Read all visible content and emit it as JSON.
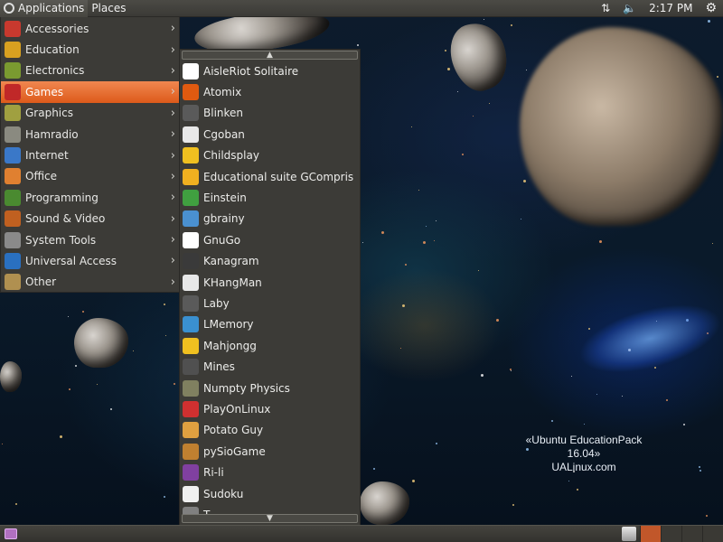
{
  "top_panel": {
    "menus": [
      "Applications",
      "Places"
    ],
    "clock": "2:17 PM"
  },
  "app_menu": {
    "items": [
      {
        "label": "Accessories",
        "icon": "accessories-icon",
        "color": "#c8392e",
        "has_submenu": true
      },
      {
        "label": "Education",
        "icon": "education-icon",
        "color": "#d8a020",
        "has_submenu": true
      },
      {
        "label": "Electronics",
        "icon": "electronics-icon",
        "color": "#7a9a30",
        "has_submenu": true
      },
      {
        "label": "Games",
        "icon": "games-icon",
        "color": "#c02828",
        "has_submenu": true,
        "selected": true
      },
      {
        "label": "Graphics",
        "icon": "graphics-icon",
        "color": "#a0a040",
        "has_submenu": true
      },
      {
        "label": "Hamradio",
        "icon": "hamradio-icon",
        "color": "#8a8a80",
        "has_submenu": true
      },
      {
        "label": "Internet",
        "icon": "internet-icon",
        "color": "#3a78c8",
        "has_submenu": true
      },
      {
        "label": "Office",
        "icon": "office-icon",
        "color": "#e08030",
        "has_submenu": true
      },
      {
        "label": "Programming",
        "icon": "programming-icon",
        "color": "#4a8a30",
        "has_submenu": true
      },
      {
        "label": "Sound & Video",
        "icon": "sound-video-icon",
        "color": "#c06020",
        "has_submenu": true
      },
      {
        "label": "System Tools",
        "icon": "system-tools-icon",
        "color": "#8a8a8a",
        "has_submenu": true
      },
      {
        "label": "Universal Access",
        "icon": "universal-access-icon",
        "color": "#2a70c0",
        "has_submenu": true
      },
      {
        "label": "Other",
        "icon": "other-icon",
        "color": "#b09050",
        "has_submenu": true
      }
    ]
  },
  "games_menu": {
    "items": [
      {
        "label": "AisleRiot Solitaire",
        "icon": "cards-icon",
        "color": "#ffffff"
      },
      {
        "label": "Atomix",
        "icon": "atomix-icon",
        "color": "#e05a10"
      },
      {
        "label": "Blinken",
        "icon": "blinken-icon",
        "color": "#5a5a5a"
      },
      {
        "label": "Cgoban",
        "icon": "cgoban-icon",
        "color": "#e8e8e8"
      },
      {
        "label": "Childsplay",
        "icon": "childsplay-icon",
        "color": "#f0c020"
      },
      {
        "label": "Educational suite GCompris",
        "icon": "gcompris-icon",
        "color": "#f0b020"
      },
      {
        "label": "Einstein",
        "icon": "einstein-icon",
        "color": "#40a040"
      },
      {
        "label": "gbrainy",
        "icon": "gbrainy-icon",
        "color": "#4a90d0"
      },
      {
        "label": "GnuGo",
        "icon": "gnugo-icon",
        "color": "#ffffff"
      },
      {
        "label": "Kanagram",
        "icon": "kanagram-icon",
        "color": "#3a3a3a"
      },
      {
        "label": "KHangMan",
        "icon": "khangman-icon",
        "color": "#e8e8e8"
      },
      {
        "label": "Laby",
        "icon": "laby-icon",
        "color": "#5a5a5a"
      },
      {
        "label": "LMemory",
        "icon": "lmemory-icon",
        "color": "#3a90d0"
      },
      {
        "label": "Mahjongg",
        "icon": "mahjongg-icon",
        "color": "#f0c020"
      },
      {
        "label": "Mines",
        "icon": "mines-icon",
        "color": "#505050"
      },
      {
        "label": "Numpty Physics",
        "icon": "numpty-icon",
        "color": "#808060"
      },
      {
        "label": "PlayOnLinux",
        "icon": "playonlinux-icon",
        "color": "#d03030"
      },
      {
        "label": "Potato Guy",
        "icon": "potato-icon",
        "color": "#e0a040"
      },
      {
        "label": "pySioGame",
        "icon": "pysiogame-icon",
        "color": "#c08030"
      },
      {
        "label": "Ri-li",
        "icon": "rili-icon",
        "color": "#8040a0"
      },
      {
        "label": "Sudoku",
        "icon": "sudoku-icon",
        "color": "#f0f0f0"
      },
      {
        "label": "T...",
        "icon": "more-icon",
        "color": "#808080"
      }
    ]
  },
  "watermark": {
    "line1": "«Ubuntu EducationPack 16.04»",
    "line2": "UALinux.com"
  },
  "accent_color": "#e8682b"
}
